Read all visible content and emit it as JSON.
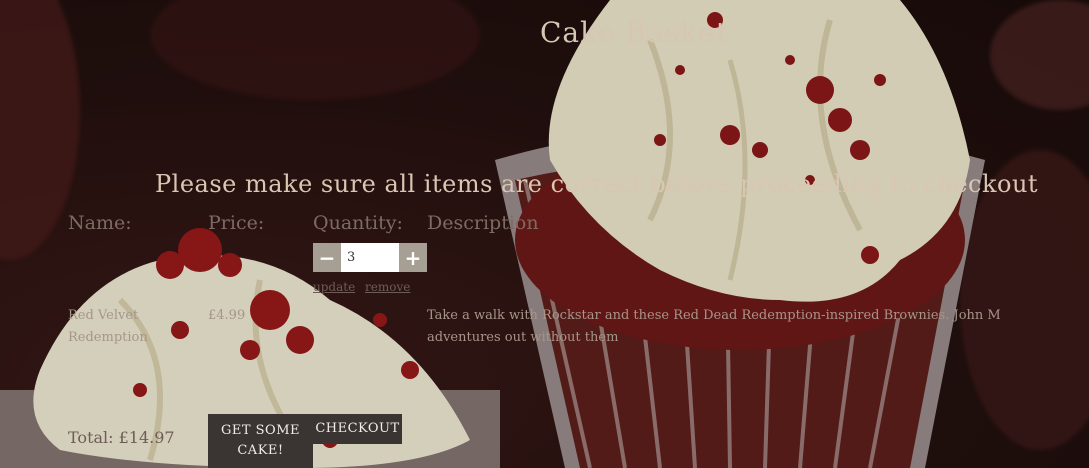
{
  "header": {
    "title": "Cake Basket"
  },
  "notice": "Please make sure all items are correct before proceeding to checkout",
  "columns": {
    "name": "Name:",
    "price": "Price:",
    "quantity": "Quantity:",
    "description": "Description"
  },
  "item": {
    "name_line1": "Red Velvet",
    "name_line2": "Redemption",
    "price": "£4.99",
    "quantity": "3",
    "description_line1": "Take a walk with Rockstar and these Red Dead Redemption-inspired Brownies.  John M",
    "description_line2": "adventures out without them",
    "update_label": "update",
    "remove_label": "remove",
    "decrement_label": "−",
    "increment_label": "+"
  },
  "footer": {
    "total": "Total: £14.97",
    "get_cake_label_line1": "GET SOME",
    "get_cake_label_line2": "CAKE!",
    "checkout_label": "CHECKOUT"
  }
}
